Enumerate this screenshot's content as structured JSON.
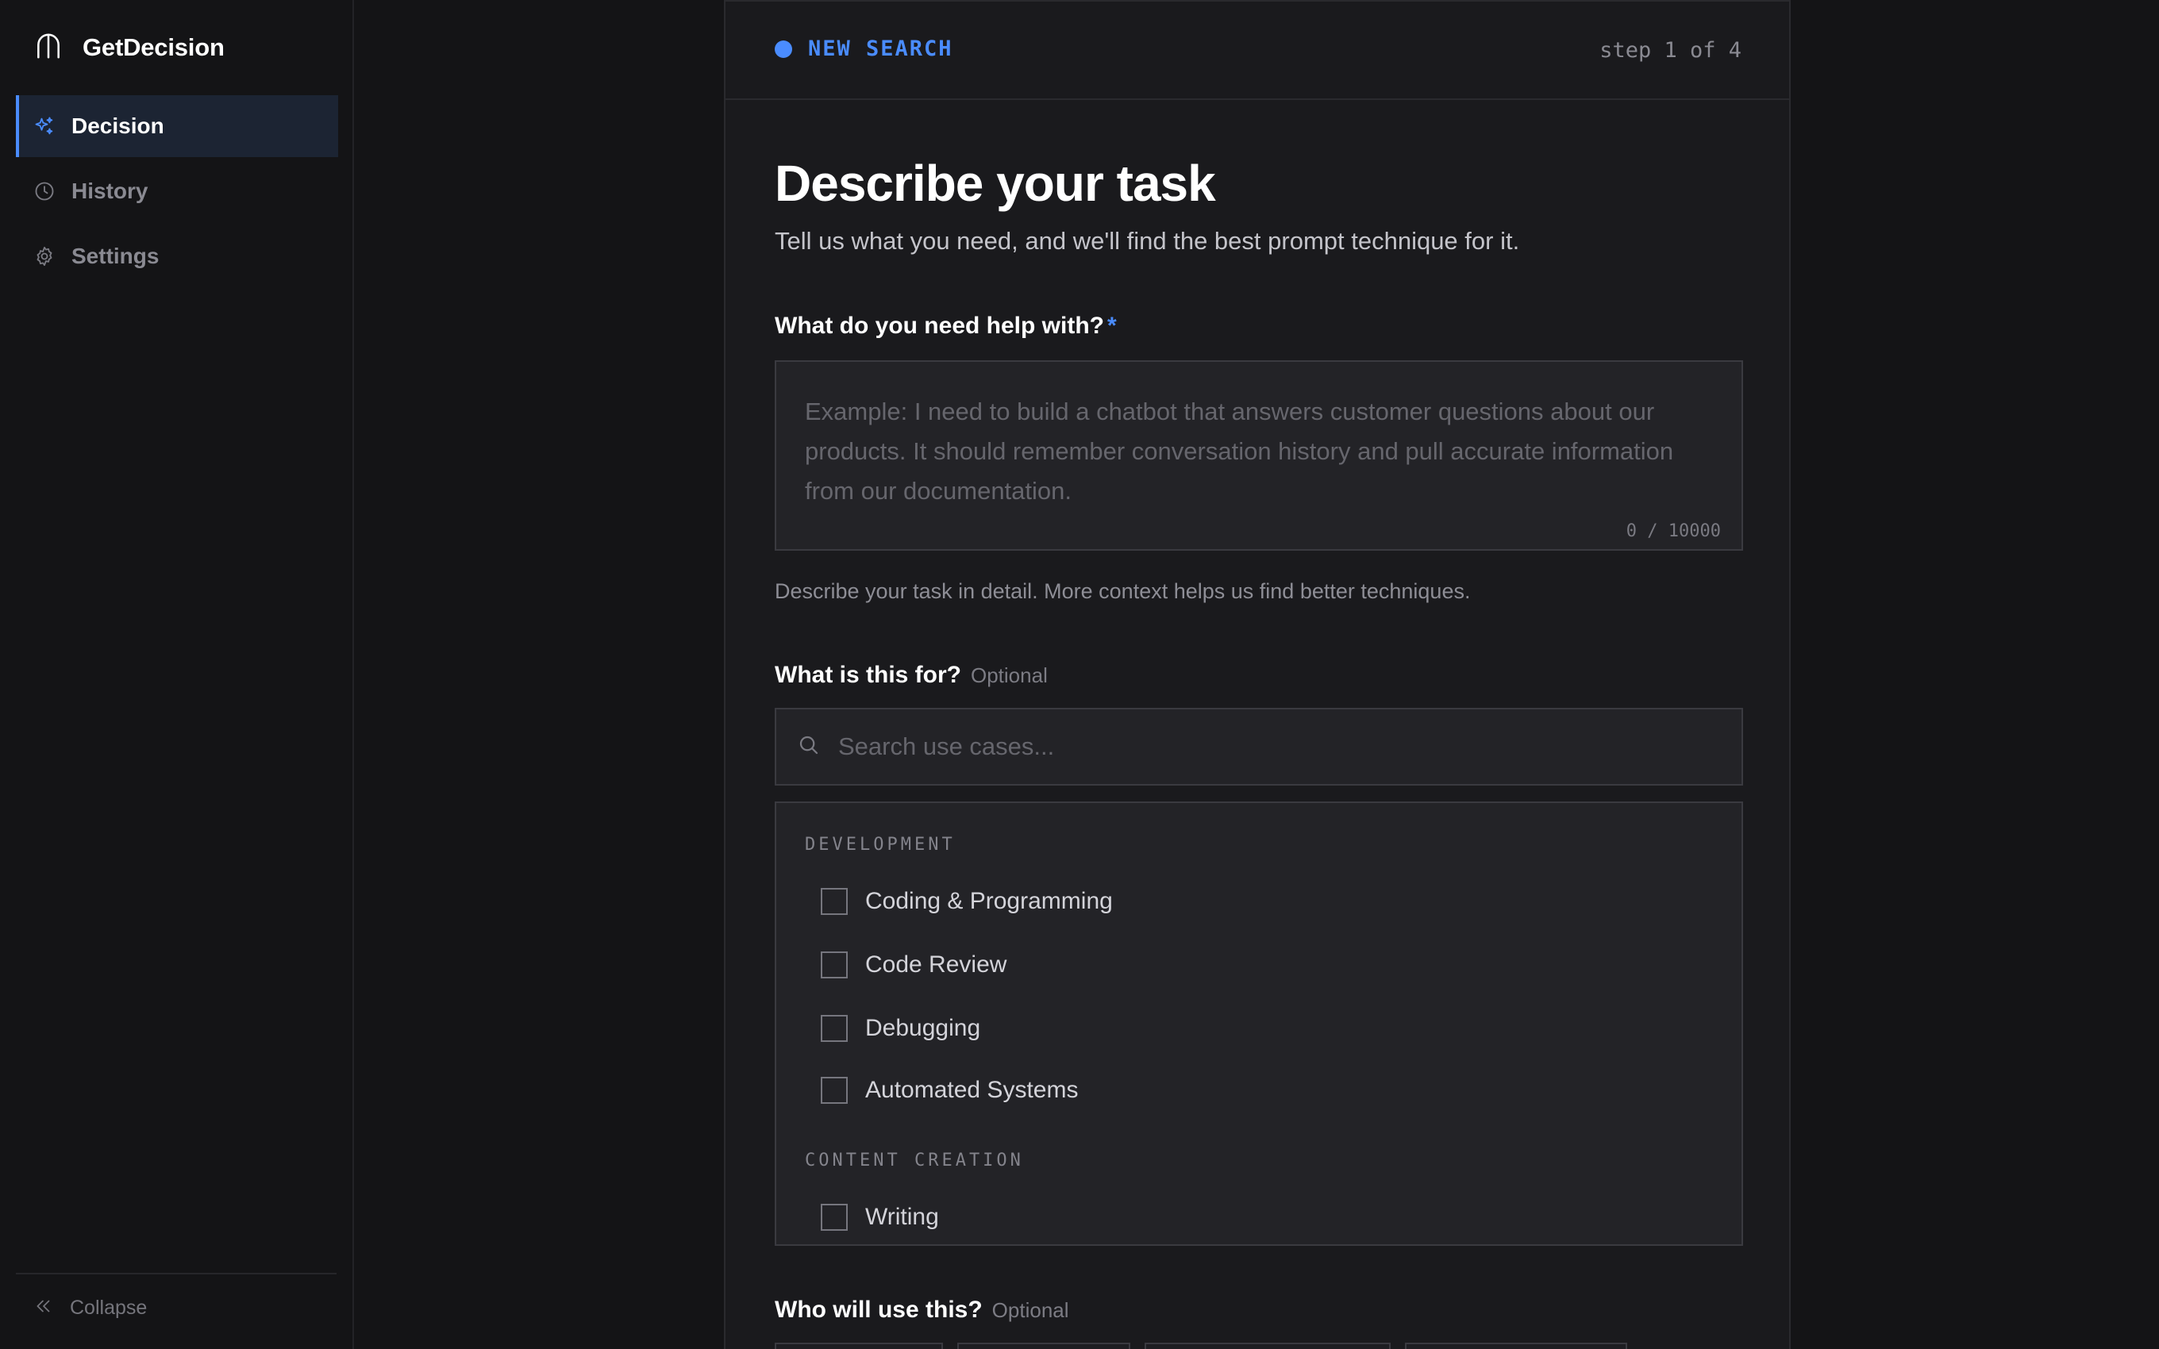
{
  "app": {
    "name": "GetDecision"
  },
  "sidebar": {
    "items": [
      {
        "label": "Decision",
        "icon": "sparkles-icon",
        "active": true
      },
      {
        "label": "History",
        "icon": "clock-icon",
        "active": false
      },
      {
        "label": "Settings",
        "icon": "gear-icon",
        "active": false
      }
    ],
    "collapse_label": "Collapse"
  },
  "header": {
    "label": "NEW SEARCH",
    "step": "step 1 of 4"
  },
  "main": {
    "title": "Describe your task",
    "subtitle": "Tell us what you need, and we'll find the best prompt technique for it.",
    "task_field": {
      "label": "What do you need help with?",
      "required_mark": "*",
      "placeholder": "Example: I need to build a chatbot that answers customer questions about our products. It should remember conversation history and pull accurate information from our documentation.",
      "counter": "0 / 10000",
      "help": "Describe your task in detail. More context helps us find better techniques."
    },
    "use_case_field": {
      "label": "What is this for?",
      "optional": "Optional",
      "search_placeholder": "Search use cases...",
      "groups": [
        {
          "name": "DEVELOPMENT",
          "options": [
            "Coding & Programming",
            "Code Review",
            "Debugging",
            "Automated Systems"
          ]
        },
        {
          "name": "CONTENT CREATION",
          "options": [
            "Writing"
          ]
        }
      ]
    },
    "audience_field": {
      "label": "Who will use this?",
      "optional": "Optional"
    }
  },
  "colors": {
    "accent": "#4a8cff",
    "background": "#141416",
    "card": "#1a1a1d"
  }
}
